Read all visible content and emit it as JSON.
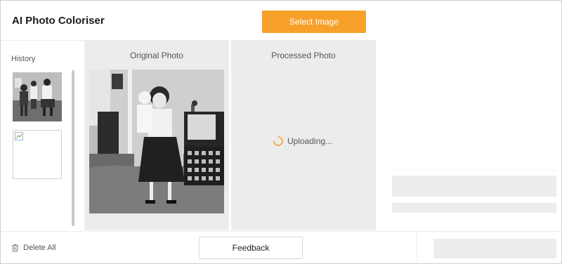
{
  "header": {
    "title": "AI Photo Coloriser",
    "select_button": "Select Image",
    "close_icon": "close-icon"
  },
  "sidebar": {
    "history_label": "History",
    "delete_all": "Delete All",
    "trash_icon": "trash-icon"
  },
  "panels": {
    "original": {
      "title": "Original Photo"
    },
    "processed": {
      "title": "Processed Photo",
      "status": "Uploading..."
    }
  },
  "footer": {
    "feedback_button": "Feedback"
  },
  "colors": {
    "accent": "#f7a12b",
    "panel_bg": "#ececec",
    "skeleton": "#ededed"
  }
}
